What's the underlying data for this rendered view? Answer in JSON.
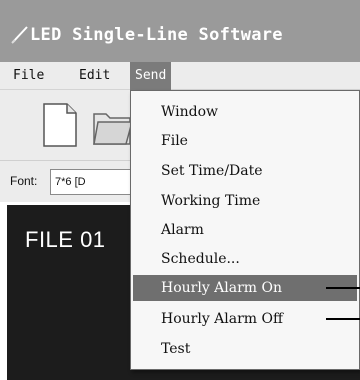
{
  "window": {
    "title": "LED Single-Line Software",
    "title_icon": "pen-icon"
  },
  "menubar": {
    "items": [
      {
        "label": "File"
      },
      {
        "label": "Edit"
      },
      {
        "label": "Send"
      }
    ],
    "active": "Send"
  },
  "toolbar": {
    "buttons": [
      {
        "icon": "new-file-icon"
      },
      {
        "icon": "open-folder-icon"
      }
    ]
  },
  "font_row": {
    "label": "Font:",
    "value": "7*6 [D"
  },
  "canvas": {
    "text": "FILE 01"
  },
  "send_menu": {
    "items": [
      {
        "label": "Window"
      },
      {
        "label": "File"
      },
      {
        "label": "Set Time/Date"
      },
      {
        "label": "Working Time"
      },
      {
        "label": "Alarm"
      },
      {
        "label": "Schedule..."
      },
      {
        "label": "Hourly Alarm On"
      },
      {
        "label": "Hourly Alarm Off"
      },
      {
        "label": "Test"
      }
    ],
    "highlighted": "Hourly Alarm On"
  },
  "colors": {
    "titlebar": "#9a9a9a",
    "menu_highlight": "#6f6f6f",
    "canvas_bg": "#1c1c1c"
  }
}
